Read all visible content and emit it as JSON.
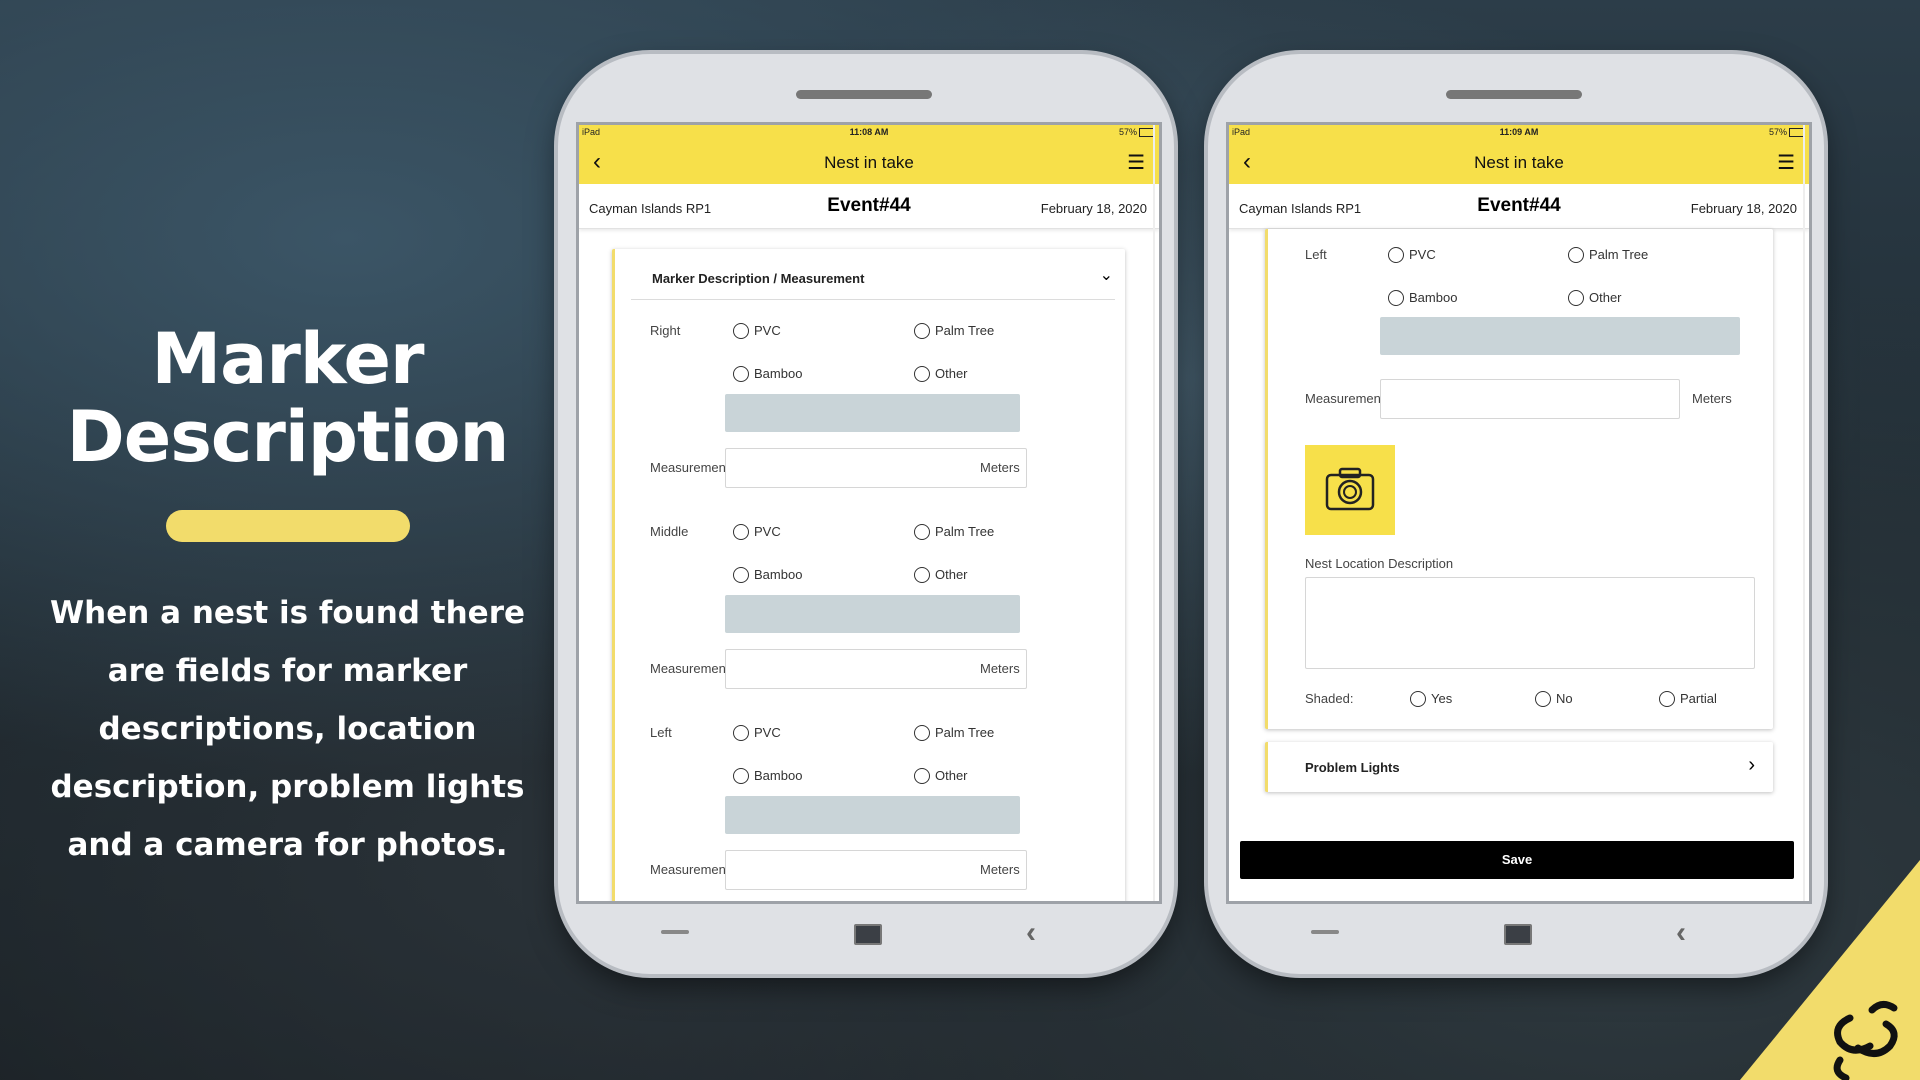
{
  "hero": {
    "title_line1": "Marker",
    "title_line2": "Description",
    "body_lines": [
      "When a nest is found there",
      "are fields for marker",
      "descriptions, location",
      "description, problem lights",
      "and a camera for photos."
    ]
  },
  "phone_left": {
    "status": {
      "carrier": "iPad",
      "time": "11:08 AM",
      "battery": "57%"
    },
    "appbar": {
      "title": "Nest in take",
      "back_icon": "chevron-left-icon",
      "menu_icon": "hamburger-icon"
    },
    "event": {
      "location": "Cayman Islands RP1",
      "number": "Event#44",
      "date": "February 18, 2020"
    },
    "section": {
      "title": "Marker Description / Measurement"
    },
    "groups": [
      {
        "label": "Right",
        "options": [
          "PVC",
          "Palm Tree",
          "Bamboo",
          "Other"
        ],
        "measurement_label": "Measurement",
        "unit": "Meters"
      },
      {
        "label": "Middle",
        "options": [
          "PVC",
          "Palm Tree",
          "Bamboo",
          "Other"
        ],
        "measurement_label": "Measurement",
        "unit": "Meters"
      },
      {
        "label": "Left",
        "options": [
          "PVC",
          "Palm Tree",
          "Bamboo",
          "Other"
        ],
        "measurement_label": "Measurement",
        "unit": "Meters"
      }
    ]
  },
  "phone_right": {
    "status": {
      "carrier": "iPad",
      "time": "11:09 AM",
      "battery": "57%"
    },
    "appbar": {
      "title": "Nest in take",
      "back_icon": "chevron-left-icon",
      "menu_icon": "hamburger-icon"
    },
    "event": {
      "location": "Cayman Islands RP1",
      "number": "Event#44",
      "date": "February 18, 2020"
    },
    "left_group": {
      "label": "Left",
      "options": [
        "PVC",
        "Palm Tree",
        "Bamboo",
        "Other"
      ],
      "measurement_label": "Measurement",
      "unit": "Meters"
    },
    "nest_location_label": "Nest Location Description",
    "shaded": {
      "label": "Shaded:",
      "options": [
        "Yes",
        "No",
        "Partial"
      ]
    },
    "problem_lights": "Problem Lights",
    "save_label": "Save"
  },
  "colors": {
    "accent": "#f7e04a",
    "accent_soft": "#f2dc6b",
    "field_grey": "#c9d4d8"
  }
}
